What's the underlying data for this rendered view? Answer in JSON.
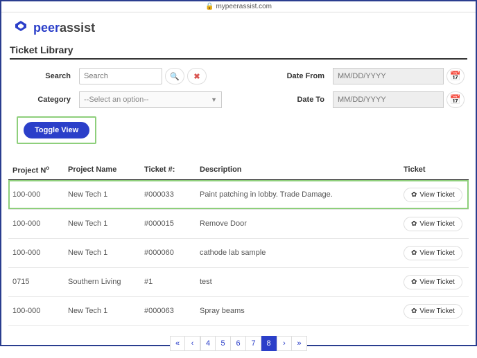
{
  "browser": {
    "host": "mypeerassist.com"
  },
  "brand": {
    "part1": "peer",
    "part2": "assist"
  },
  "page": {
    "title": "Ticket Library"
  },
  "filters": {
    "search_label": "Search",
    "search_placeholder": "Search",
    "category_label": "Category",
    "category_placeholder": "--Select an option--",
    "date_from_label": "Date From",
    "date_to_label": "Date To",
    "date_placeholder": "MM/DD/YYYY",
    "toggle_label": "Toggle View"
  },
  "table": {
    "headers": {
      "project_no_pre": "Project N",
      "project_no_sup": "o",
      "project_name": "Project Name",
      "ticket_num": "Ticket #:",
      "description": "Description",
      "ticket": "Ticket"
    },
    "view_label": "View Ticket",
    "rows": [
      {
        "project_no": "100-000",
        "project_name": "New Tech 1",
        "ticket_num": "#000033",
        "description": "Paint patching in lobby. Trade Damage.",
        "highlight": true
      },
      {
        "project_no": "100-000",
        "project_name": "New Tech 1",
        "ticket_num": "#000015",
        "description": "Remove Door",
        "highlight": false
      },
      {
        "project_no": "100-000",
        "project_name": "New Tech 1",
        "ticket_num": "#000060",
        "description": "cathode lab sample",
        "highlight": false
      },
      {
        "project_no": "0715",
        "project_name": "Southern Living",
        "ticket_num": "#1",
        "description": "test",
        "highlight": false
      },
      {
        "project_no": "100-000",
        "project_name": "New Tech 1",
        "ticket_num": "#000063",
        "description": "Spray beams",
        "highlight": false
      }
    ]
  },
  "pagination": {
    "first": "«",
    "prev": "‹",
    "pages": [
      "4",
      "5",
      "6",
      "7",
      "8"
    ],
    "current": "8",
    "next": "›",
    "last": "»"
  }
}
